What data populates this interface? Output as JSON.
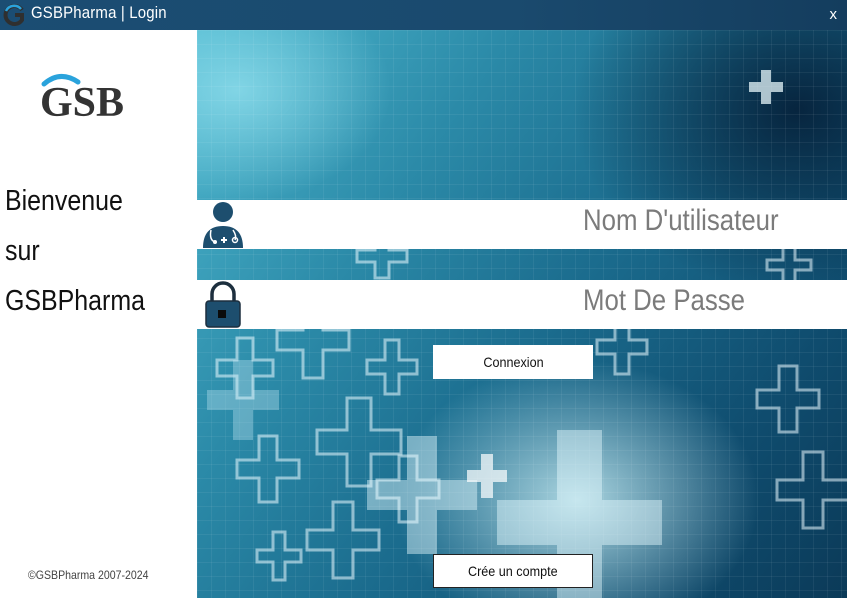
{
  "window": {
    "title": "GSBPharma  |  Login",
    "close_label": "x",
    "icon": "gsb-logo-icon"
  },
  "left_panel": {
    "logo_text": "GSB",
    "welcome_line1": "Bienvenue",
    "welcome_line2": "sur",
    "welcome_line3": "GSBPharma",
    "copyright": "©GSBPharma 2007-2024"
  },
  "form": {
    "username_placeholder": "Nom D'utilisateur",
    "username_value": "",
    "username_icon": "doctor-user-icon",
    "password_placeholder": "Mot De Passe",
    "password_value": "",
    "password_icon": "padlock-icon",
    "login_button": "Connexion",
    "signup_button": "Crée un compte"
  },
  "colors": {
    "titlebar": "#1b4d73",
    "logo_accent": "#2aa3dc",
    "logo_dark": "#333333",
    "icon_dark": "#1d4e6e",
    "background_teal": "#1a6a8c"
  }
}
